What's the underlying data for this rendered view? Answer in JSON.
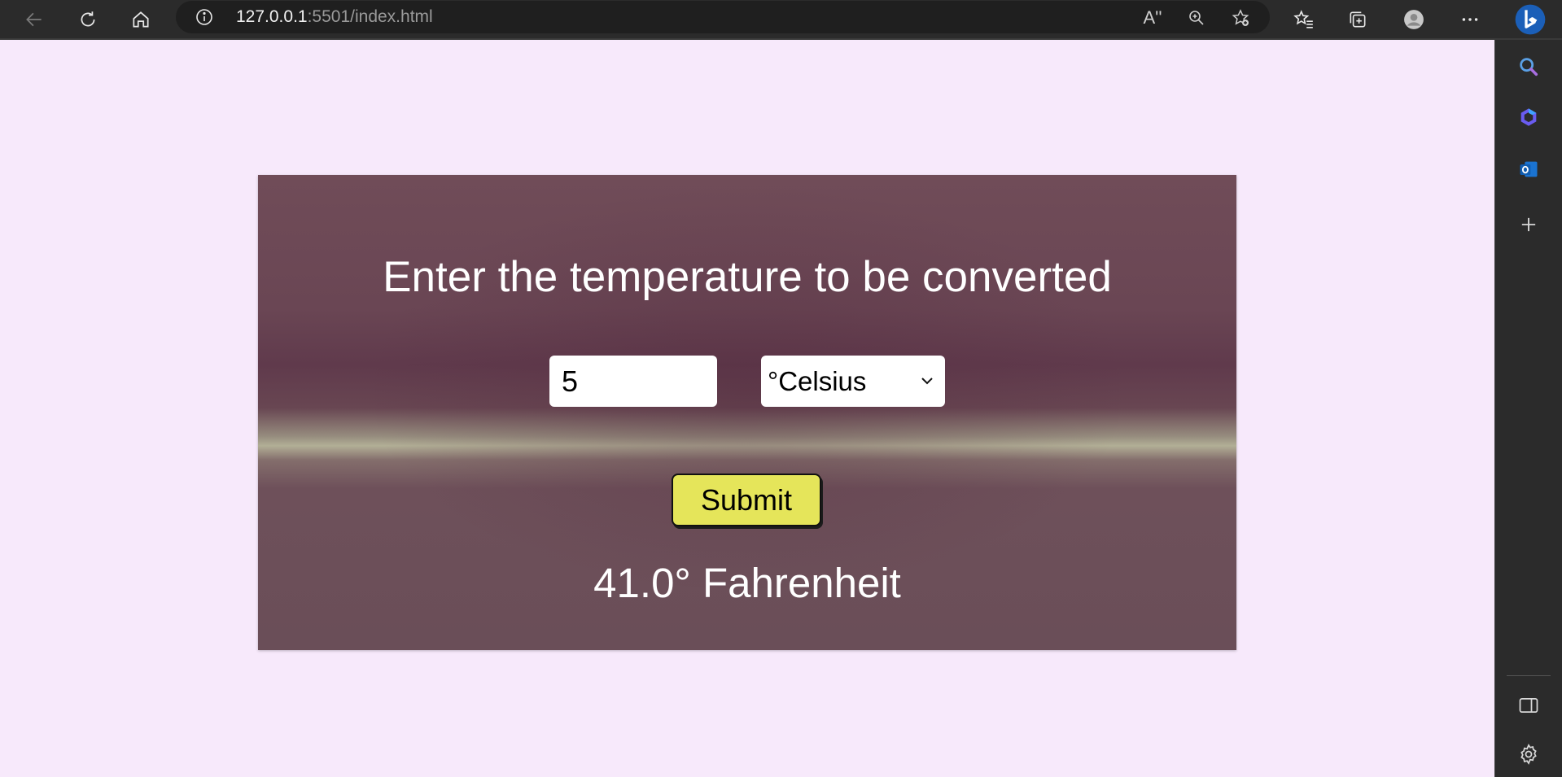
{
  "browser": {
    "url_host": "127.0.0.1",
    "url_rest": ":5501/index.html",
    "read_aloud_label": "A''"
  },
  "icons": {
    "back": "back-arrow-icon",
    "refresh": "refresh-icon",
    "home": "home-icon",
    "info": "site-info-icon",
    "read_aloud": "read-aloud-icon",
    "zoom": "zoom-icon",
    "add_favorite": "add-favorite-icon",
    "favorites": "favorites-icon",
    "collections": "collections-icon",
    "profile": "profile-avatar-icon",
    "more": "more-options-icon",
    "copilot": "copilot-icon",
    "sidebar_search": "search-icon",
    "sidebar_copilot": "copilot-sidebar-icon",
    "sidebar_outlook": "outlook-icon",
    "sidebar_add": "add-icon",
    "sidebar_toggle": "sidebar-toggle-icon",
    "sidebar_settings": "settings-icon"
  },
  "colors": {
    "page_background": "#f7e9fb",
    "submit_button": "#e5e55a",
    "card_text": "#ffffff"
  },
  "converter": {
    "title": "Enter the temperature to be converted",
    "temperature_value": "5",
    "unit_selected": "°Celsius",
    "submit_label": "Submit",
    "result": "41.0° Fahrenheit"
  }
}
